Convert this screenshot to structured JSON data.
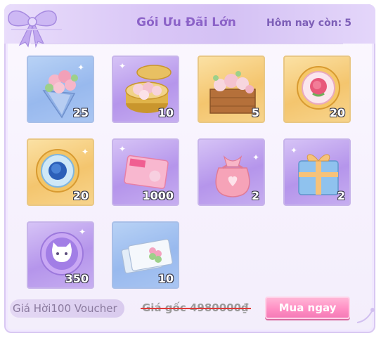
{
  "header": {
    "title": "Gói Ưu Đãi Lớn",
    "remaining_label": "Hôm nay còn:",
    "remaining_value": "5"
  },
  "items": [
    {
      "name": "rose-bouquet",
      "quantity": "25",
      "bg": "blue"
    },
    {
      "name": "flower-box-gold",
      "quantity": "10",
      "bg": "purple"
    },
    {
      "name": "rose-crate",
      "quantity": "5",
      "bg": "gold"
    },
    {
      "name": "rose-badge",
      "quantity": "20",
      "bg": "gold"
    },
    {
      "name": "blue-rose-badge",
      "quantity": "20",
      "bg": "gold"
    },
    {
      "name": "pink-ticket",
      "quantity": "1000",
      "bg": "purple"
    },
    {
      "name": "heart-pouch",
      "quantity": "2",
      "bg": "purple"
    },
    {
      "name": "gift-box",
      "quantity": "2",
      "bg": "purple"
    },
    {
      "name": "cat-coin",
      "quantity": "350",
      "bg": "purple"
    },
    {
      "name": "clover-tickets",
      "quantity": "10",
      "bg": "blue"
    }
  ],
  "footer": {
    "voucher_label": "Giá Hời",
    "voucher_amount": "100 Voucher",
    "price_label": "Giá gốc",
    "price_value": "4980000₫",
    "buy_label": "Mua ngay"
  },
  "colors": {
    "title": "#8c63c8",
    "buy_button": "#ff8fc4",
    "strike": "#e03a3a"
  }
}
